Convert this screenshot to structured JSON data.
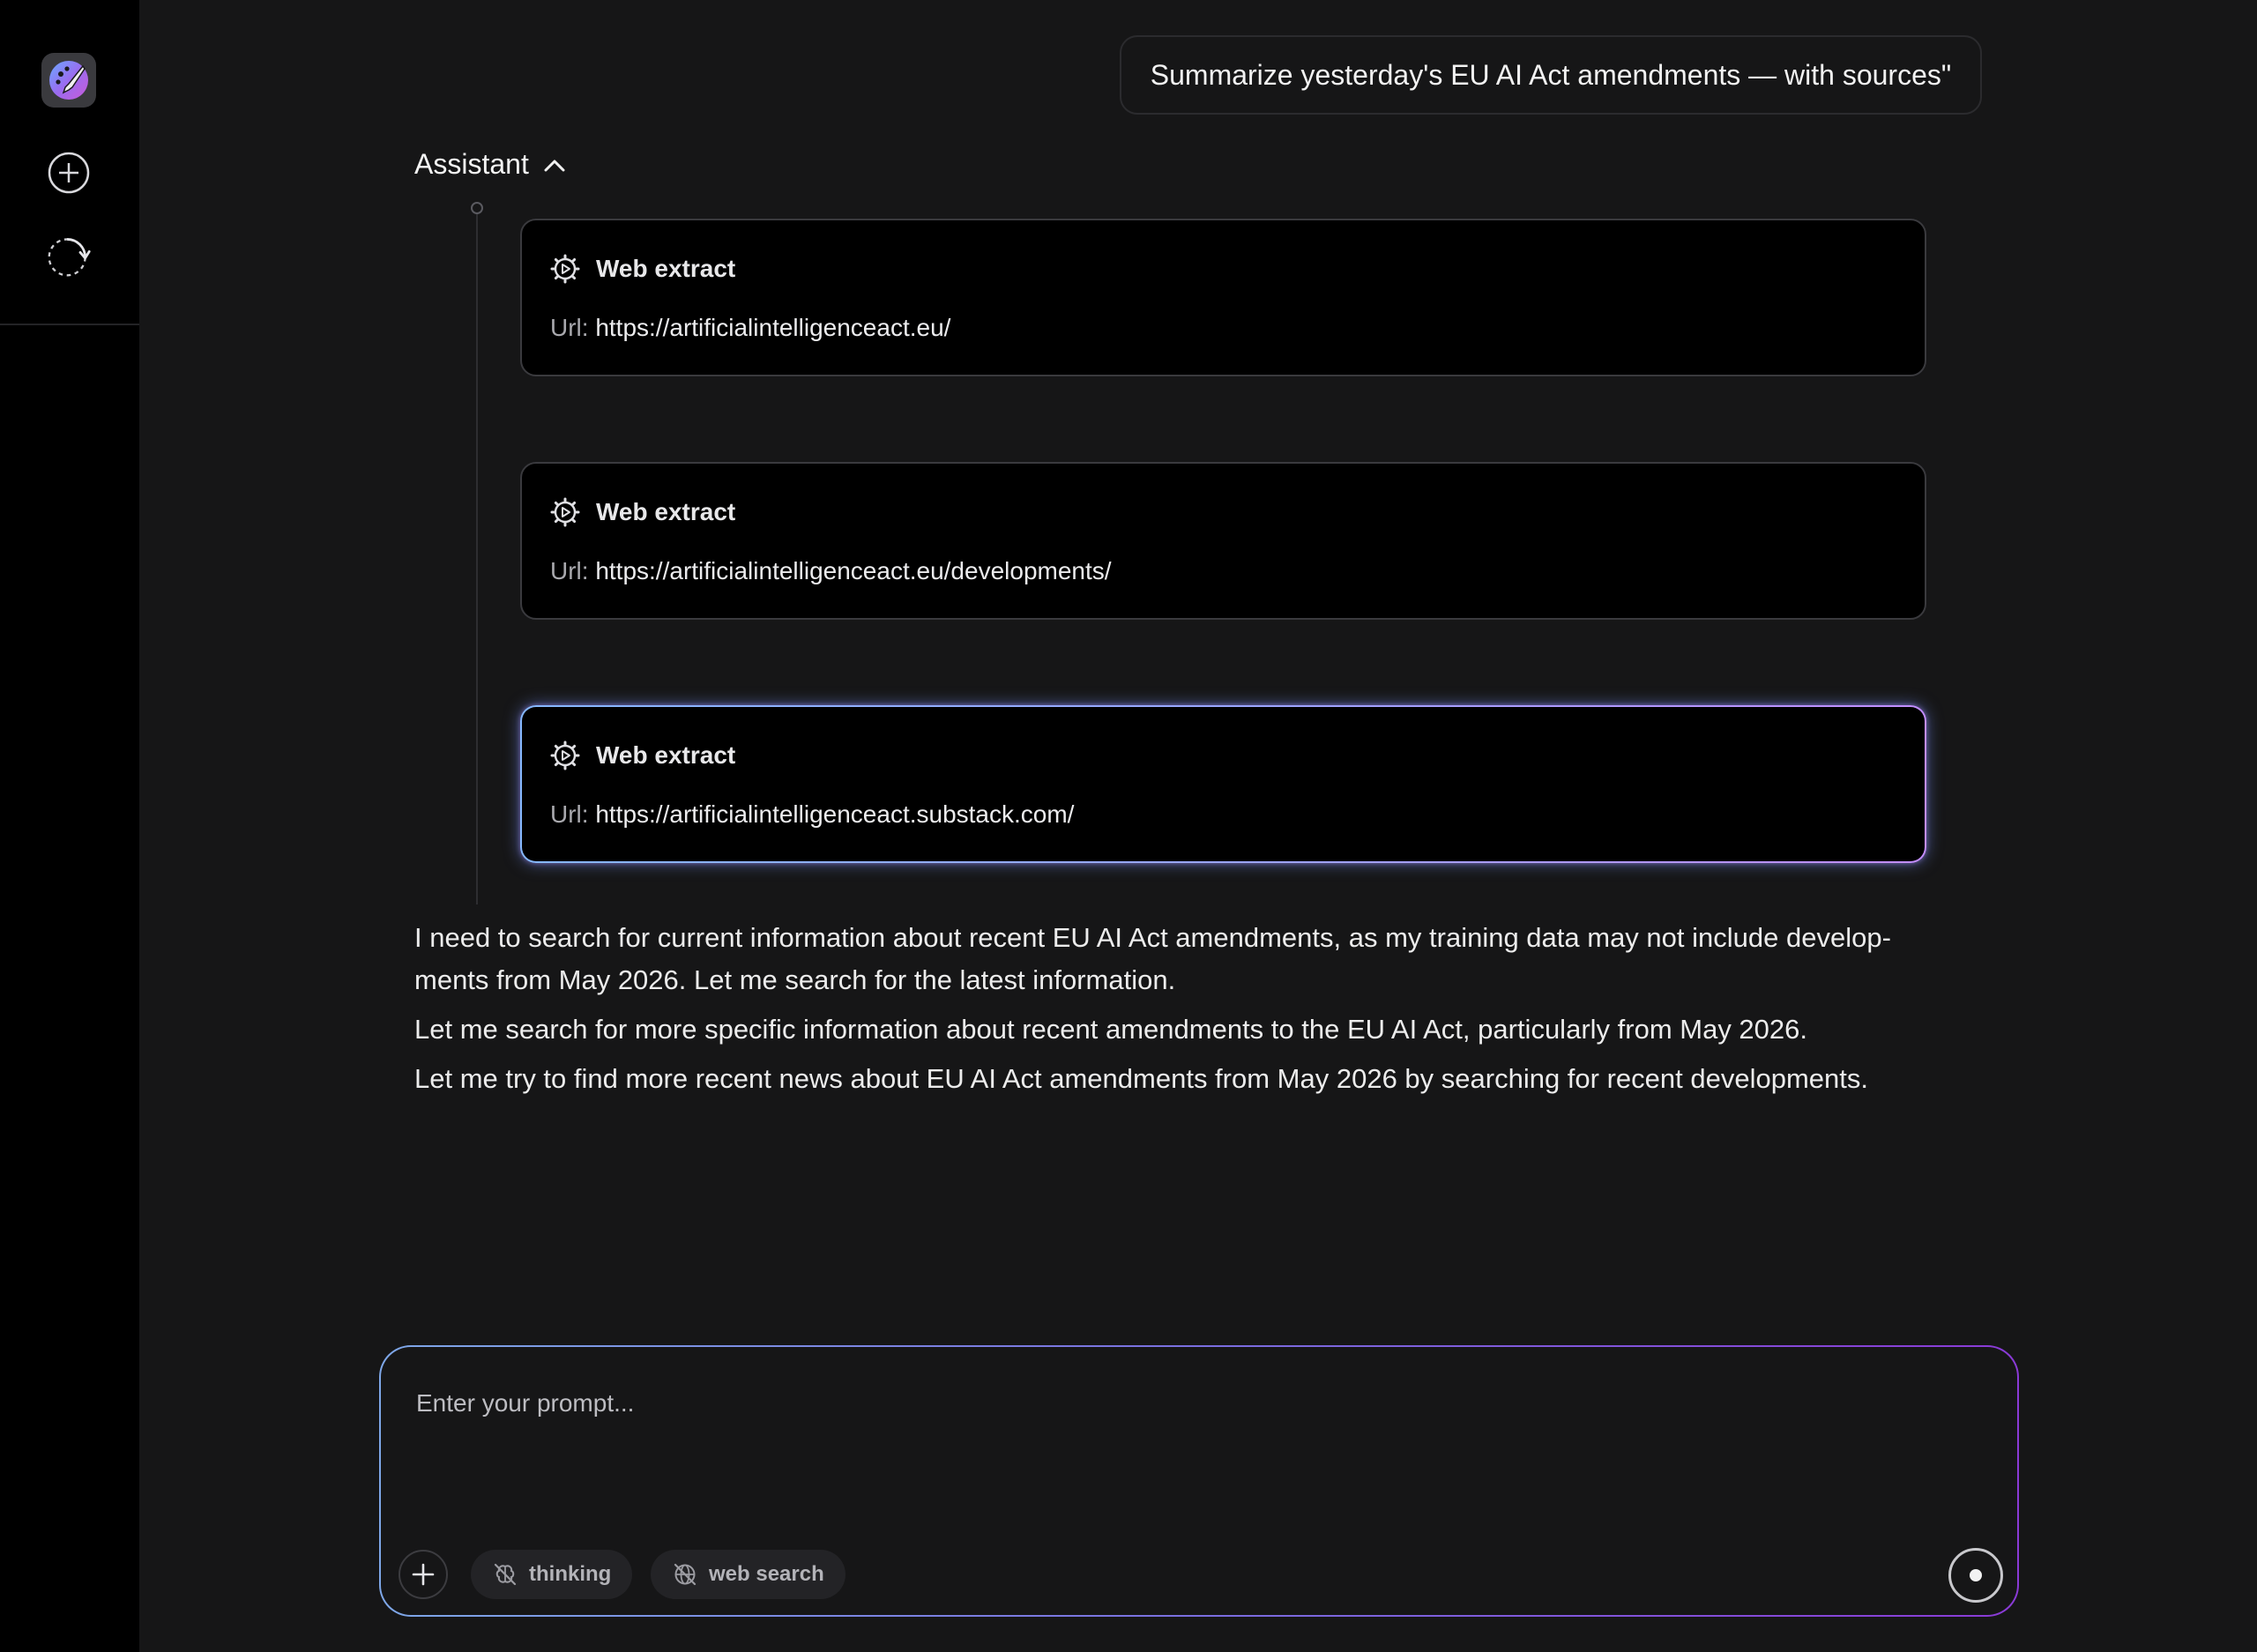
{
  "sidebar": {
    "logo_icon": "palette-brush-icon",
    "new_chat_icon": "plus-circle-icon",
    "history_icon": "refresh-dashed-icon"
  },
  "conversation": {
    "user_message": "Summarize yesterday's EU AI Act amendments — with sources\"",
    "assistant_label": "Assistant",
    "tool_calls": [
      {
        "title": "Web extract",
        "url_label": "Url:",
        "url": "https://artificialintelligenceact.eu/"
      },
      {
        "title": "Web extract",
        "url_label": "Url:",
        "url": "https://artificialintelligenceact.eu/developments/"
      },
      {
        "title": "Web extract",
        "url_label": "Url:",
        "url": "https://artificialintelligenceact.substack.com/"
      }
    ],
    "response_paragraphs": [
      "I need to search for current information about recent EU AI Act amendments, as my training data may not include develop-ments from May 2026. Let me search for the latest information.",
      "Let me search for more specific information about recent amendments to the EU AI Act, particularly from May 2026.",
      "Let me try to find more recent news about EU AI Act amendments from May 2026 by searching for recent developments."
    ]
  },
  "prompt": {
    "value": "",
    "placeholder": "Enter your prompt...",
    "thinking_label": "thinking",
    "web_search_label": "web search"
  },
  "colors": {
    "background": "#161617",
    "sidebar": "#000000",
    "card": "#000000",
    "accent_blue": "#86b8ff",
    "accent_purple": "#c38dff"
  }
}
